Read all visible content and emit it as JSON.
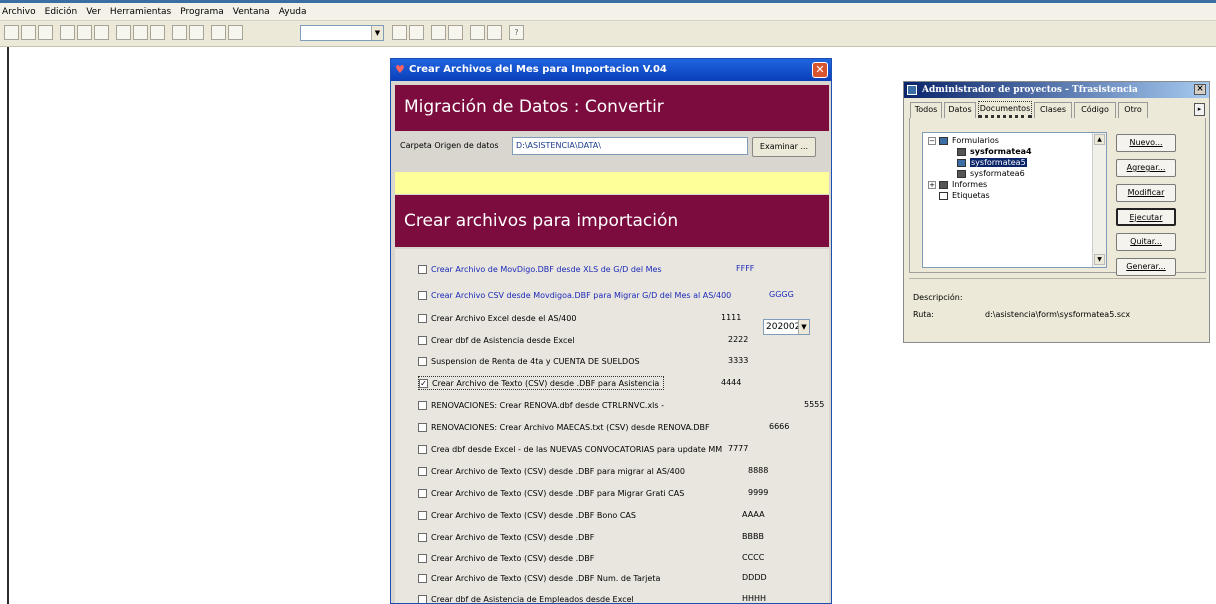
{
  "menu": [
    "Archivo",
    "Edición",
    "Ver",
    "Herramientas",
    "Programa",
    "Ventana",
    "Ayuda"
  ],
  "dialog": {
    "title": "Crear Archivos del Mes para Importacion  V.04",
    "band1": "Migración de Datos : Convertir",
    "source_label": "Carpeta Origen de datos",
    "source_value": "D:\\ASISTENCIA\\DATA\\",
    "browse_label": "Examinar ...",
    "band2": "Crear archivos para importación",
    "period_value": "202002",
    "options": [
      {
        "label": "Crear Archivo de  MovDigo.DBF desde XLS de G/D  del Mes",
        "code": "FFFF",
        "checked": false,
        "blue": true
      },
      {
        "label": "Crear Archivo CSV desde  Movdigoa.DBF  para Migrar G/D del Mes al AS/400",
        "code": "GGGG",
        "checked": false,
        "blue": true
      },
      {
        "label": "Crear  Archivo  Excel  desde  el AS/400",
        "code": "1111",
        "checked": false,
        "blue": false
      },
      {
        "label": "Crear  dbf de Asistencia  desde  Excel",
        "code": "2222",
        "checked": false,
        "blue": false
      },
      {
        "label": "Suspension de Renta de 4ta y CUENTA DE SUELDOS",
        "code": "3333",
        "checked": false,
        "blue": false
      },
      {
        "label": "Crear Archivo de Texto (CSV) desde  .DBF  para Asistencia",
        "code": "4444",
        "checked": true,
        "blue": false
      },
      {
        "label": "RENOVACIONES: Crear  RENOVA.dbf  desde   CTRLRNVC.xls -",
        "code": "5555",
        "checked": false,
        "blue": false
      },
      {
        "label": "RENOVACIONES: Crear Archivo MAECAS.txt (CSV) desde  RENOVA.DBF",
        "code": "6666",
        "checked": false,
        "blue": false
      },
      {
        "label": "Crea dbf desde Excel - de las NUEVAS CONVOCATORIAS para update MM",
        "code": "7777",
        "checked": false,
        "blue": false
      },
      {
        "label": "Crear Archivo de Texto (CSV) desde  .DBF  para migrar al AS/400",
        "code": "8888",
        "checked": false,
        "blue": false
      },
      {
        "label": "Crear Archivo de Texto (CSV) desde  .DBF  para Migrar Grati CAS",
        "code": "9999",
        "checked": false,
        "blue": false
      },
      {
        "label": "Crear Archivo de Texto (CSV) desde  .DBF  Bono CAS",
        "code": "AAAA",
        "checked": false,
        "blue": false
      },
      {
        "label": "Crear Archivo de Texto (CSV) desde  .DBF",
        "code": "BBBB",
        "checked": false,
        "blue": false
      },
      {
        "label": "Crear Archivo de Texto (CSV) desde  .DBF",
        "code": "CCCC",
        "checked": false,
        "blue": false
      },
      {
        "label": "Crear Archivo de Texto (CSV) desde  .DBF Num. de Tarjeta",
        "code": "DDDD",
        "checked": false,
        "blue": false
      },
      {
        "label": "Crear  dbf de Asistencia  de Empleados desde  Excel",
        "code": "HHHH",
        "checked": false,
        "blue": false
      }
    ]
  },
  "project_manager": {
    "title": "Administrador de proyectos - Tfrasistencia",
    "close": "×",
    "tabs": [
      "Todos",
      "Datos",
      "Documentos",
      "Clases",
      "Código",
      "Otro"
    ],
    "tree": {
      "formularios": "Formularios",
      "items": [
        "sysformatea4",
        "sysformatea5",
        "sysformatea6"
      ],
      "informes": "Informes",
      "etiquetas": "Etiquetas"
    },
    "buttons": [
      "Nuevo...",
      "Agregar...",
      "Modificar",
      "Ejecutar",
      "Quitar...",
      "Generar..."
    ],
    "desc_label": "Descripción:",
    "ruta_label": "Ruta:",
    "ruta_value": "d:\\asistencia\\form\\sysformatea5.scx"
  }
}
